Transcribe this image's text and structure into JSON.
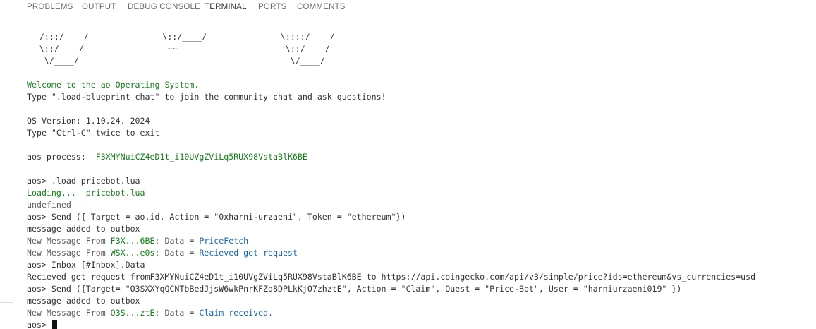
{
  "tabs": [
    {
      "label": "PROBLEMS",
      "active": false
    },
    {
      "label": "OUTPUT",
      "active": false
    },
    {
      "label": "DEBUG CONSOLE",
      "active": false
    },
    {
      "label": "TERMINAL",
      "active": true
    },
    {
      "label": "PORTS",
      "active": false
    },
    {
      "label": "COMMENTS",
      "active": false
    }
  ],
  "terminal": {
    "ascii_art": [
      "        /:::/    /               \\::/____/               \\::::/    /",
      "        \\::/    /                 ~~                      \\::/    /",
      "         \\/____/                                           \\/____/"
    ],
    "welcome": "Welcome to the ao Operating System.",
    "hint": "Type \".load-blueprint chat\" to join the community chat and ask questions!",
    "os_version": "OS Version: 1.10.24. 2024",
    "exit_hint": "Type \"Ctrl-C\" twice to exit",
    "process_label": "aos process:  ",
    "process_id": "F3XMYNuiCZ4eD1t_i10UVgZViLq5RUX98VstaBlK6BE",
    "cmd1": "aos> .load pricebot.lua",
    "loading": "Loading...  pricebot.lua",
    "undefined": "undefined",
    "cmd2": "aos> Send ({ Target = ao.id, Action = \"0xharni-urzaeni\", Token = \"ethereum\"})",
    "outbox1": "message added to outbox",
    "msg1_prefix": "New Message From ",
    "msg1_from": "F3X...6BE",
    "msg1_mid": ": Data = ",
    "msg1_data": "PriceFetch",
    "msg2_prefix": "New Message From ",
    "msg2_from": "WSX...e0s",
    "msg2_mid": ": Data = ",
    "msg2_data": "Recieved get request",
    "cmd3": "aos> Inbox [#Inbox].Data",
    "inbox_data": "Recieved get request fromF3XMYNuiCZ4eD1t_i10UVgZViLq5RUX98VstaBlK6BE to https://api.coingecko.com/api/v3/simple/price?ids=ethereum&vs_currencies=usd",
    "cmd4": "aos> Send ({Target= \"O3SXXYqQCNTbBedJjsW6wkPnrKFZq8DPLkKjO7zhztE\", Action = \"Claim\", Quest = \"Price-Bot\", User = \"harniurzaeni019\" })",
    "outbox2": "message added to outbox",
    "msg3_prefix": "New Message From ",
    "msg3_from": "O3S...ztE",
    "msg3_mid": ": Data = ",
    "msg3_data": "Claim received.",
    "prompt": "aos> "
  },
  "colors": {
    "green": "#15801a",
    "blue": "#1466b8",
    "text": "#333333",
    "muted": "#5c5c5c"
  }
}
